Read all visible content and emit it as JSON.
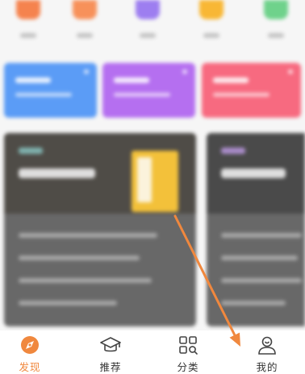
{
  "colors": {
    "active_tab": "#f0883e",
    "tab_text": "#333333",
    "annotation_arrow": "#f0883e",
    "quick_entry_colors": [
      "#f5834e",
      "#f7915a",
      "#9d7ef0",
      "#f8b735",
      "#6fd28b"
    ],
    "feature_card_colors": [
      "#5b9cf6",
      "#b56ff0",
      "#f76a80"
    ],
    "content_card_tag_colors": [
      "#7fb0ad",
      "#a98cc9"
    ]
  },
  "tab_bar": {
    "items": [
      {
        "label": "发现",
        "icon": "compass-icon",
        "active": true
      },
      {
        "label": "推荐",
        "icon": "graduation-cap-icon",
        "active": false
      },
      {
        "label": "分类",
        "icon": "category-grid-icon",
        "active": false
      },
      {
        "label": "我的",
        "icon": "profile-icon",
        "active": false
      }
    ]
  }
}
